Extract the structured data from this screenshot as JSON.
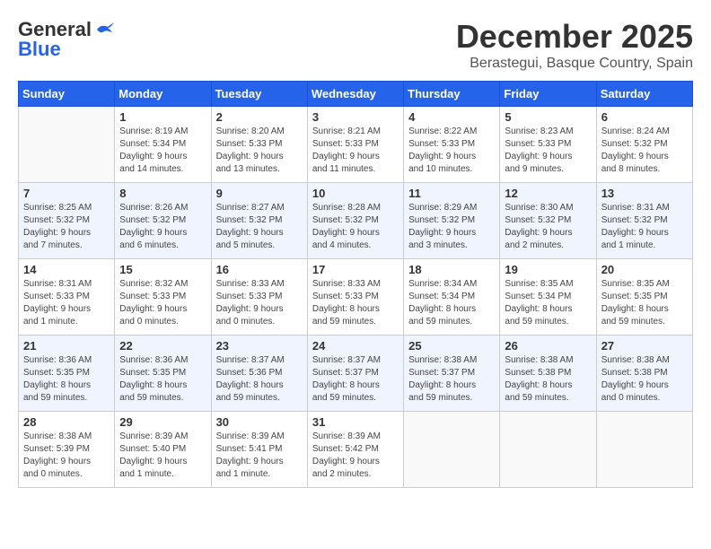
{
  "logo": {
    "general": "General",
    "blue": "Blue"
  },
  "title": {
    "month": "December 2025",
    "location": "Berastegui, Basque Country, Spain"
  },
  "weekdays": [
    "Sunday",
    "Monday",
    "Tuesday",
    "Wednesday",
    "Thursday",
    "Friday",
    "Saturday"
  ],
  "weeks": [
    [
      {
        "day": "",
        "info": ""
      },
      {
        "day": "1",
        "info": "Sunrise: 8:19 AM\nSunset: 5:34 PM\nDaylight: 9 hours\nand 14 minutes."
      },
      {
        "day": "2",
        "info": "Sunrise: 8:20 AM\nSunset: 5:33 PM\nDaylight: 9 hours\nand 13 minutes."
      },
      {
        "day": "3",
        "info": "Sunrise: 8:21 AM\nSunset: 5:33 PM\nDaylight: 9 hours\nand 11 minutes."
      },
      {
        "day": "4",
        "info": "Sunrise: 8:22 AM\nSunset: 5:33 PM\nDaylight: 9 hours\nand 10 minutes."
      },
      {
        "day": "5",
        "info": "Sunrise: 8:23 AM\nSunset: 5:33 PM\nDaylight: 9 hours\nand 9 minutes."
      },
      {
        "day": "6",
        "info": "Sunrise: 8:24 AM\nSunset: 5:32 PM\nDaylight: 9 hours\nand 8 minutes."
      }
    ],
    [
      {
        "day": "7",
        "info": "Sunrise: 8:25 AM\nSunset: 5:32 PM\nDaylight: 9 hours\nand 7 minutes."
      },
      {
        "day": "8",
        "info": "Sunrise: 8:26 AM\nSunset: 5:32 PM\nDaylight: 9 hours\nand 6 minutes."
      },
      {
        "day": "9",
        "info": "Sunrise: 8:27 AM\nSunset: 5:32 PM\nDaylight: 9 hours\nand 5 minutes."
      },
      {
        "day": "10",
        "info": "Sunrise: 8:28 AM\nSunset: 5:32 PM\nDaylight: 9 hours\nand 4 minutes."
      },
      {
        "day": "11",
        "info": "Sunrise: 8:29 AM\nSunset: 5:32 PM\nDaylight: 9 hours\nand 3 minutes."
      },
      {
        "day": "12",
        "info": "Sunrise: 8:30 AM\nSunset: 5:32 PM\nDaylight: 9 hours\nand 2 minutes."
      },
      {
        "day": "13",
        "info": "Sunrise: 8:31 AM\nSunset: 5:32 PM\nDaylight: 9 hours\nand 1 minute."
      }
    ],
    [
      {
        "day": "14",
        "info": "Sunrise: 8:31 AM\nSunset: 5:33 PM\nDaylight: 9 hours\nand 1 minute."
      },
      {
        "day": "15",
        "info": "Sunrise: 8:32 AM\nSunset: 5:33 PM\nDaylight: 9 hours\nand 0 minutes."
      },
      {
        "day": "16",
        "info": "Sunrise: 8:33 AM\nSunset: 5:33 PM\nDaylight: 9 hours\nand 0 minutes."
      },
      {
        "day": "17",
        "info": "Sunrise: 8:33 AM\nSunset: 5:33 PM\nDaylight: 8 hours\nand 59 minutes."
      },
      {
        "day": "18",
        "info": "Sunrise: 8:34 AM\nSunset: 5:34 PM\nDaylight: 8 hours\nand 59 minutes."
      },
      {
        "day": "19",
        "info": "Sunrise: 8:35 AM\nSunset: 5:34 PM\nDaylight: 8 hours\nand 59 minutes."
      },
      {
        "day": "20",
        "info": "Sunrise: 8:35 AM\nSunset: 5:35 PM\nDaylight: 8 hours\nand 59 minutes."
      }
    ],
    [
      {
        "day": "21",
        "info": "Sunrise: 8:36 AM\nSunset: 5:35 PM\nDaylight: 8 hours\nand 59 minutes."
      },
      {
        "day": "22",
        "info": "Sunrise: 8:36 AM\nSunset: 5:35 PM\nDaylight: 8 hours\nand 59 minutes."
      },
      {
        "day": "23",
        "info": "Sunrise: 8:37 AM\nSunset: 5:36 PM\nDaylight: 8 hours\nand 59 minutes."
      },
      {
        "day": "24",
        "info": "Sunrise: 8:37 AM\nSunset: 5:37 PM\nDaylight: 8 hours\nand 59 minutes."
      },
      {
        "day": "25",
        "info": "Sunrise: 8:38 AM\nSunset: 5:37 PM\nDaylight: 8 hours\nand 59 minutes."
      },
      {
        "day": "26",
        "info": "Sunrise: 8:38 AM\nSunset: 5:38 PM\nDaylight: 8 hours\nand 59 minutes."
      },
      {
        "day": "27",
        "info": "Sunrise: 8:38 AM\nSunset: 5:38 PM\nDaylight: 9 hours\nand 0 minutes."
      }
    ],
    [
      {
        "day": "28",
        "info": "Sunrise: 8:38 AM\nSunset: 5:39 PM\nDaylight: 9 hours\nand 0 minutes."
      },
      {
        "day": "29",
        "info": "Sunrise: 8:39 AM\nSunset: 5:40 PM\nDaylight: 9 hours\nand 1 minute."
      },
      {
        "day": "30",
        "info": "Sunrise: 8:39 AM\nSunset: 5:41 PM\nDaylight: 9 hours\nand 1 minute."
      },
      {
        "day": "31",
        "info": "Sunrise: 8:39 AM\nSunset: 5:42 PM\nDaylight: 9 hours\nand 2 minutes."
      },
      {
        "day": "",
        "info": ""
      },
      {
        "day": "",
        "info": ""
      },
      {
        "day": "",
        "info": ""
      }
    ]
  ]
}
